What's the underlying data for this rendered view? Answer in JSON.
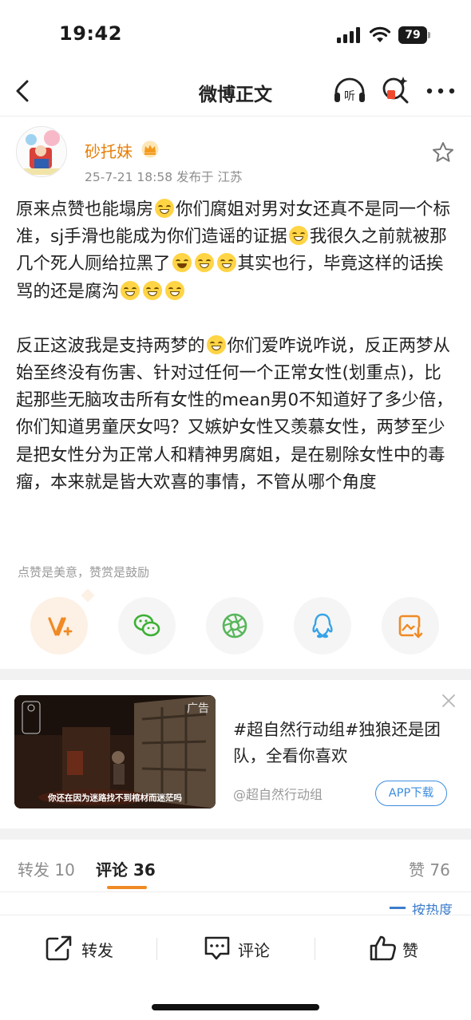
{
  "status_bar": {
    "time": "19:42",
    "battery": "79"
  },
  "nav": {
    "title": "微博正文",
    "listen_label": "听"
  },
  "post": {
    "author": "砂托妹",
    "meta": "25-7-21 18:58  发布于 江苏",
    "paragraph1": [
      "原来点赞也能塌房",
      "你们腐姐对男对女还真不是同一个标准，sj手滑也能成为你们造谣的证据",
      "我很久之前就被那几个死人厕给拉黑了",
      "其实也行，毕竟这样的话挨骂的还是腐沟"
    ],
    "paragraph2": [
      "反正这波我是支持两梦的",
      "你们爱咋说咋说，反正两梦从始至终没有伤害、针对过任何一个正常女性(划重点)，比起那些无脑攻击所有女性的mean男0不知道好了多少倍，你们知道男童厌女吗？又嫉妒女性又羡慕女性，两梦至少是把女性分为正常人和精神男腐姐，是在剔除女性中的毒瘤，本来就是皆大欢喜的事情，不管从哪个角度"
    ],
    "reward_line": "点赞是美意，赞赏是鼓励"
  },
  "share": {
    "icons": [
      "reward-icon",
      "wechat-icon",
      "moments-icon",
      "qq-icon",
      "save-image-icon"
    ]
  },
  "ad": {
    "label": "广告",
    "caption": "你还在因为迷路找不到棺材而迷茫吗",
    "title": "#超自然行动组#独狼还是团队，全看你喜欢",
    "source": "@超自然行动组",
    "button": "APP下载"
  },
  "tabs": {
    "repost": "转发 10",
    "comment": "评论 36",
    "like": "赞 76",
    "sort": "按热度"
  },
  "actions": {
    "repost": "转发",
    "comment": "评论",
    "like": "赞"
  },
  "colors": {
    "accent_orange": "#f08a24",
    "username": "#e87e04",
    "link_blue": "#3d8de0"
  }
}
